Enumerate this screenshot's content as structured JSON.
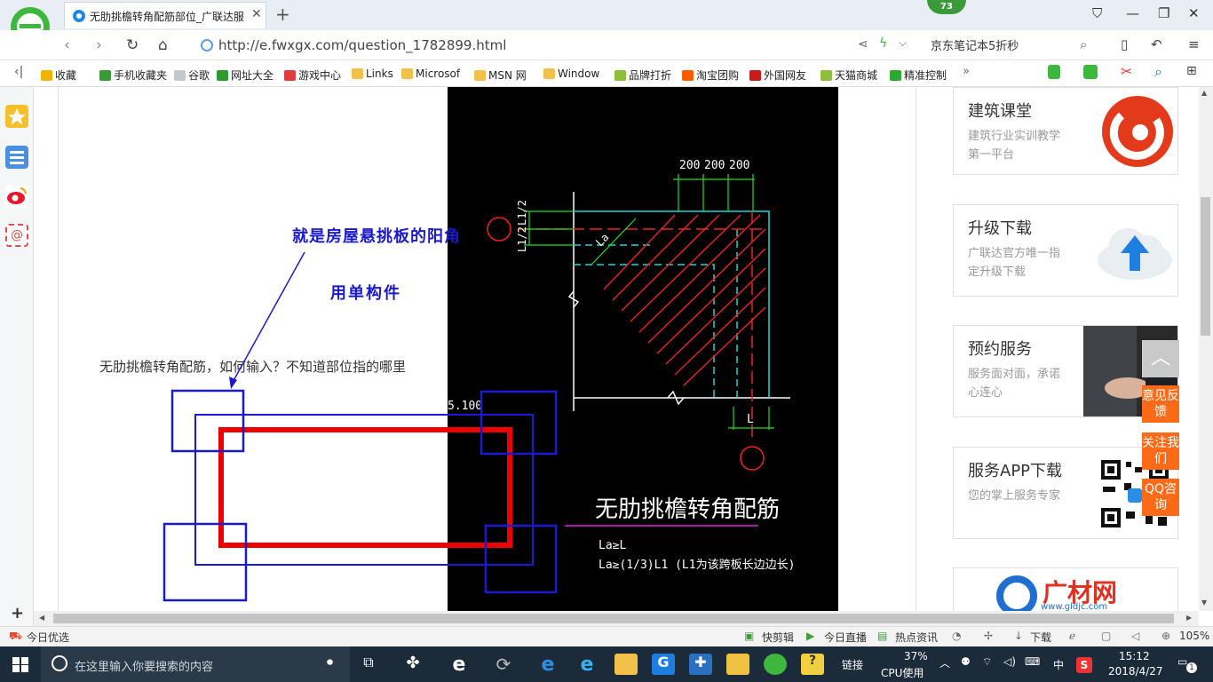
{
  "browser": {
    "tab_title": "无肋挑檐转角配筋部位_广联达服",
    "badge_count": "73",
    "url": "http://e.fwxgx.com/question_1782899.html",
    "search_text": "京东笔记本5折秒",
    "zoom": "105%"
  },
  "bookmarks": [
    {
      "label": "收藏",
      "icon": "star-icon",
      "color": "#f0b400"
    },
    {
      "label": "手机收藏夹",
      "icon": "phone-icon",
      "color": "#3a9a3a"
    },
    {
      "label": "谷歌",
      "icon": "page-icon",
      "color": "#c0c8d0"
    },
    {
      "label": "网址大全",
      "icon": "globe-icon",
      "color": "#2f9a2f"
    },
    {
      "label": "游戏中心",
      "icon": "game-icon",
      "color": "#e23b3b"
    },
    {
      "label": "Links",
      "icon": "folder-icon",
      "color": "#f2c14a"
    },
    {
      "label": "Microsof",
      "icon": "folder-icon",
      "color": "#f2c14a"
    },
    {
      "label": "MSN 网",
      "icon": "folder-icon",
      "color": "#f2c14a"
    },
    {
      "label": "Window",
      "icon": "folder-icon",
      "color": "#f2c14a"
    },
    {
      "label": "品牌打折",
      "icon": "leaf-icon",
      "color": "#8bbf3c"
    },
    {
      "label": "淘宝团购",
      "icon": "taobao-icon",
      "color": "#ff5a00"
    },
    {
      "label": "外国网友",
      "icon": "flag-icon",
      "color": "#c81a1a"
    },
    {
      "label": "天猫商城",
      "icon": "leaf-icon",
      "color": "#8bbf3c"
    },
    {
      "label": "精准控制",
      "icon": "chat-icon",
      "color": "#2ea832"
    }
  ],
  "content": {
    "question": "无肋挑檐转角配筋，如何输入？不知道部位指的哪里",
    "annotation_line1": "就是房屋悬挑板的阳角",
    "annotation_line2": "用单构件",
    "elevation": "5.100"
  },
  "drawing": {
    "dims": [
      "200",
      "200",
      "200"
    ],
    "l2_labels": [
      "L1/2",
      "L1/2"
    ],
    "la_label": "La",
    "l_label": "L",
    "title": "无肋挑檐转角配筋",
    "note1": "La≥L",
    "note2": "La≥(1/3)L1  (L1为该跨板长边边长)"
  },
  "sidebar": {
    "cards": [
      {
        "title": "建筑课堂",
        "desc": "建筑行业实训教学第一平台"
      },
      {
        "title": "升级下载",
        "desc": "广联达官方唯一指定升级下载"
      },
      {
        "title": "预约服务",
        "desc": "服务面对面，承诺心连心"
      },
      {
        "title": "服务APP下载",
        "desc": "您的掌上服务专家"
      }
    ],
    "brand_name": "广材网",
    "brand_url": "www.gldjc.com",
    "float_buttons": [
      "意见反馈",
      "关注我们",
      "QQ咨询"
    ]
  },
  "statusbar": {
    "left": "今日优选",
    "items": [
      "快剪辑",
      "今日直播",
      "热点资讯",
      "下载"
    ],
    "zoom": "105%"
  },
  "taskbar": {
    "search_placeholder": "在这里输入你要搜索的内容",
    "link_label": "链接",
    "cpu_value": "37%",
    "cpu_label": "CPU使用",
    "ime": "中",
    "time": "15:12",
    "date": "2018/4/27",
    "notif_count": "1"
  },
  "colors": {
    "annotation": "#1a1acc",
    "red_frame": "#ee0000",
    "blue_frame": "#1a1ad0",
    "cad_bg": "#000000",
    "orange": "#ff6a17"
  }
}
